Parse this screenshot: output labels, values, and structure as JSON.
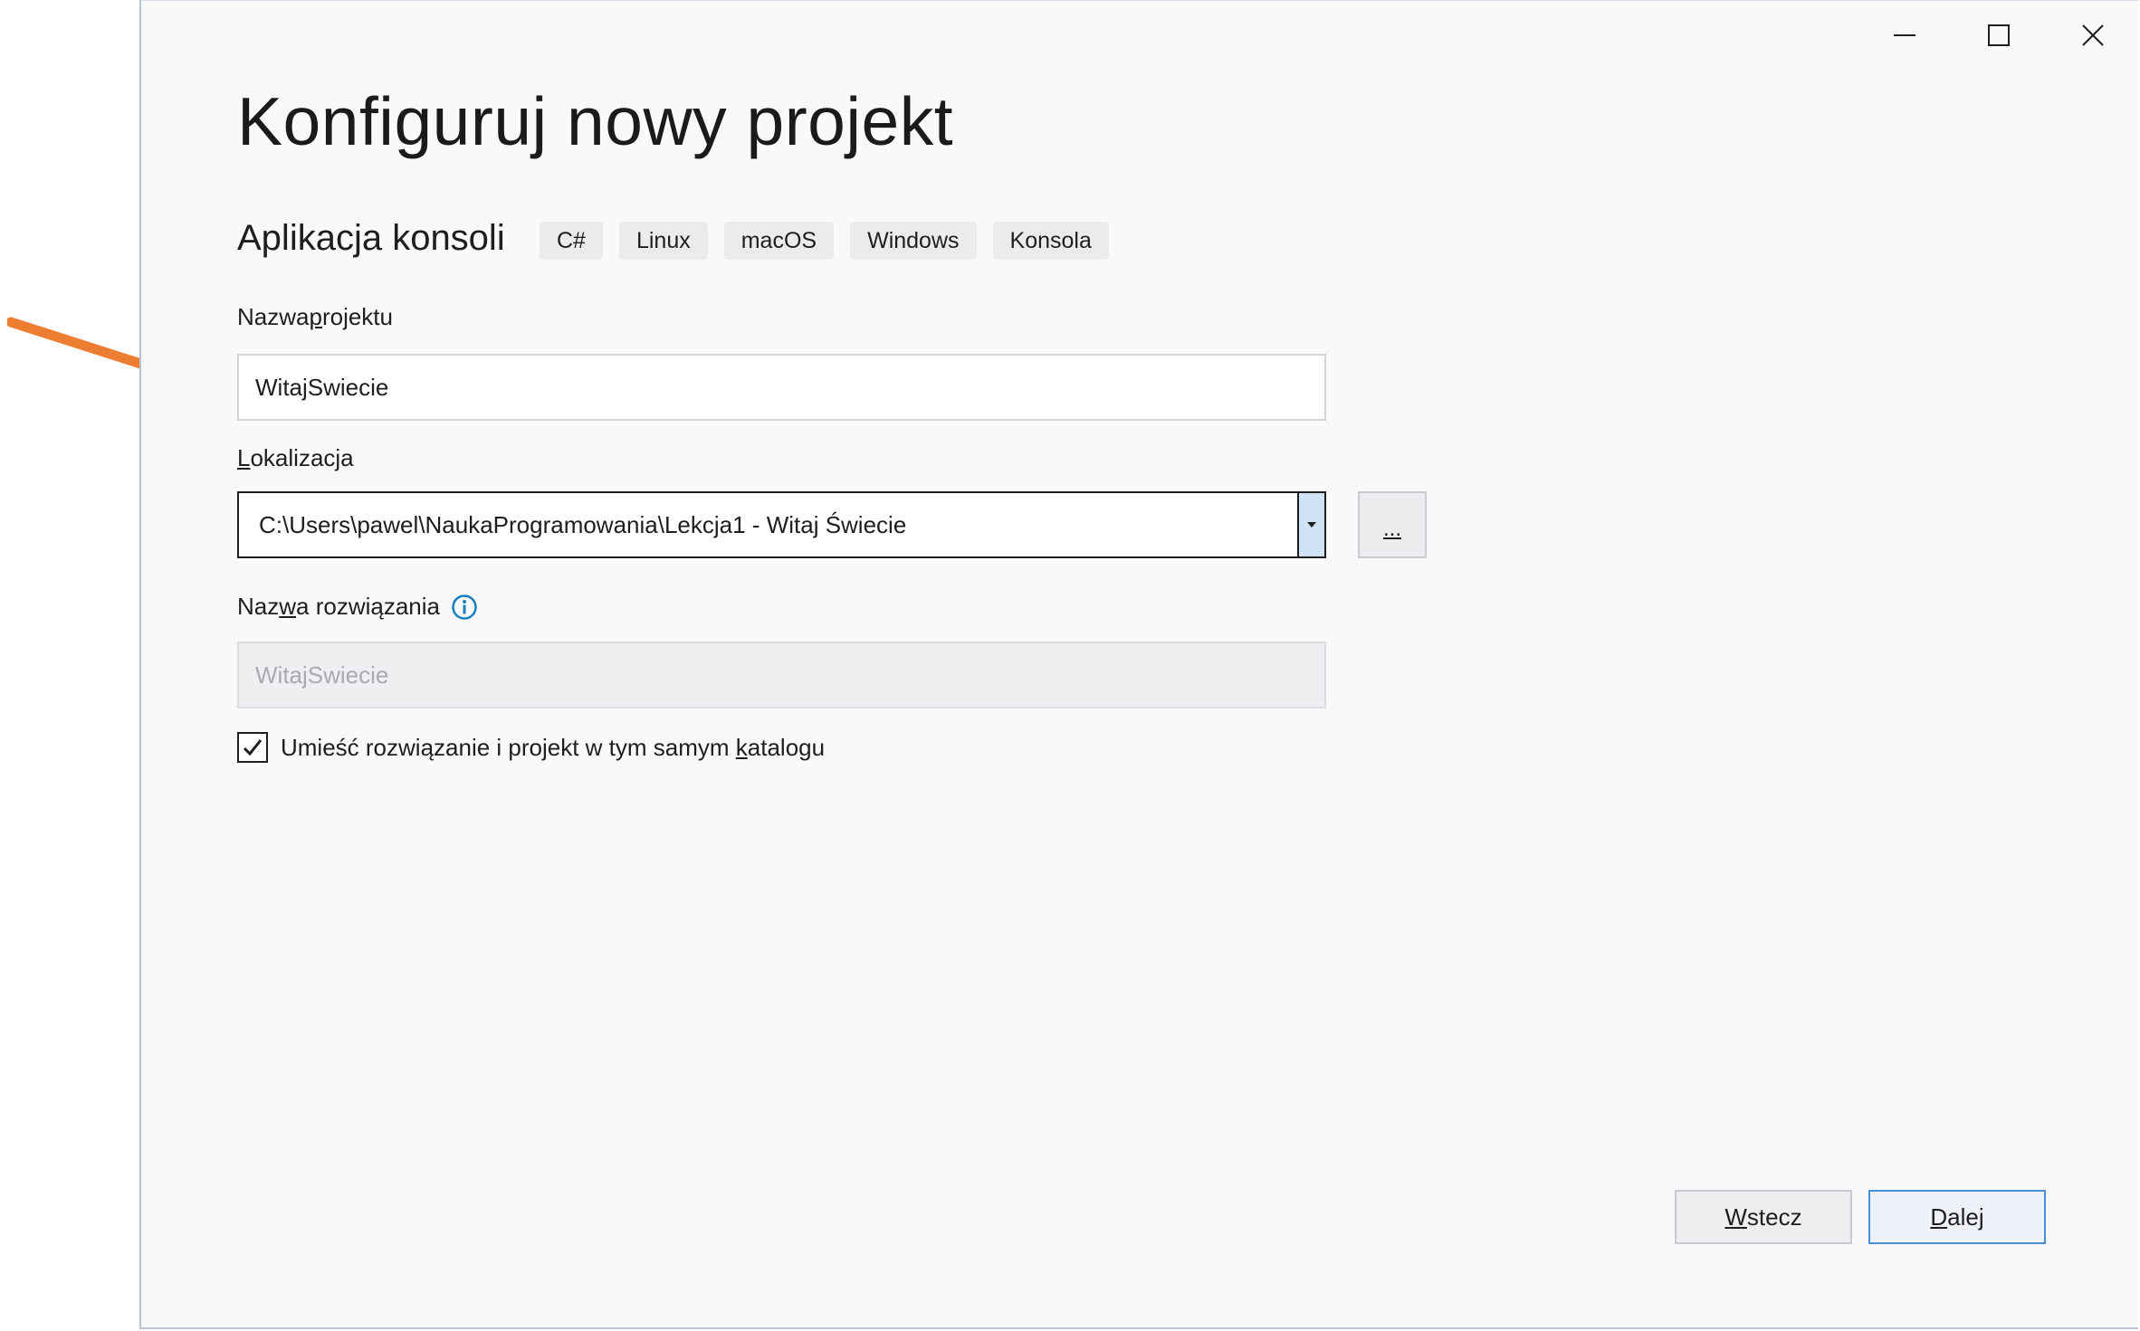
{
  "window": {
    "controls": {
      "minimize": "minimize-icon",
      "maximize": "maximize-icon",
      "close": "close-icon"
    }
  },
  "page": {
    "title": "Konfiguruj nowy projekt",
    "template_name": "Aplikacja konsoli",
    "tags": [
      "C#",
      "Linux",
      "macOS",
      "Windows",
      "Konsola"
    ]
  },
  "form": {
    "project_name": {
      "label_pre": "Nazwa ",
      "label_accel": "p",
      "label_post": "rojektu",
      "value": "WitajSwiecie"
    },
    "location": {
      "label_pre": "",
      "label_accel": "L",
      "label_post": "okalizacja",
      "value": "C:\\Users\\pawel\\NaukaProgramowania\\Lekcja1 - Witaj Świecie",
      "browse_label": "..."
    },
    "solution_name": {
      "label_pre": "Naz",
      "label_accel": "w",
      "label_post": "a rozwiązania",
      "value": "WitajSwiecie",
      "info_icon": "info-icon"
    },
    "same_directory": {
      "label_pre": "Umieść rozwiązanie i projekt w tym samym ",
      "label_accel": "k",
      "label_post": "atalogu",
      "checked": true
    }
  },
  "footer": {
    "back": {
      "accel": "W",
      "rest": "stecz"
    },
    "next": {
      "accel": "D",
      "rest": "alej"
    }
  },
  "colors": {
    "arrow": "#ed7d31",
    "info": "#1a7fc1",
    "primary_border": "#4a90d6",
    "dropdown_button": "#cfe2f6"
  }
}
